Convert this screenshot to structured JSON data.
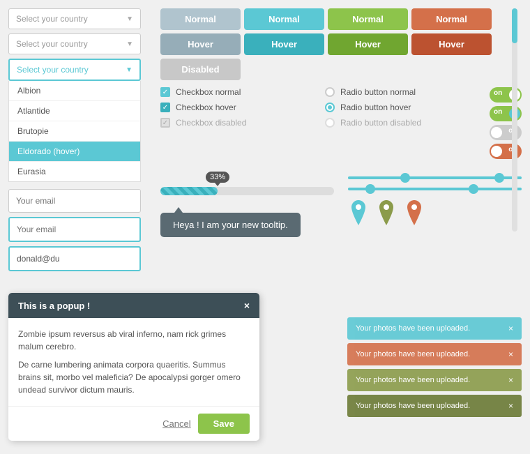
{
  "dropdowns": {
    "normal1": {
      "placeholder": "Select your country",
      "arrow": "▼"
    },
    "normal2": {
      "placeholder": "Select your country",
      "arrow": "▼"
    },
    "active": {
      "placeholder": "Select your country",
      "arrow": "▼"
    },
    "items": [
      "Albion",
      "Atlantide",
      "Brutopie",
      "Eldorado (hover)",
      "Eurasia"
    ]
  },
  "inputs": {
    "placeholder1": "Your email",
    "placeholder2": "Your email",
    "value3": "donald@du"
  },
  "buttons": {
    "row1": [
      "Normal",
      "Normal",
      "Normal",
      "Normal"
    ],
    "row2": [
      "Hover",
      "Hover",
      "Hover",
      "Hover"
    ],
    "row3": [
      "Disabled"
    ]
  },
  "checkboxes": {
    "normal": "Checkbox normal",
    "hover": "Checkbox hover",
    "disabled": "Checkbox disabled"
  },
  "radios": {
    "normal": "Radio button normal",
    "hover": "Radio button hover",
    "disabled": "Radio button disabled"
  },
  "toggles": {
    "on1": "on",
    "on2": "on",
    "off1": "off",
    "off2": "off"
  },
  "slider": {
    "percent": "33%"
  },
  "tooltip": {
    "text": "Heya ! I am your new tooltip."
  },
  "popup": {
    "title": "This is a popup !",
    "close": "×",
    "body1": "Zombie ipsum reversus ab viral inferno, nam rick grimes malum cerebro.",
    "body2": "De carne lumbering animata corpora quaeritis. Summus brains sit, morbo vel maleficia? De apocalypsi gorger omero undead survivor dictum mauris.",
    "cancel": "Cancel",
    "save": "Save"
  },
  "notifications": {
    "text": "Your photos have been uploaded.",
    "close": "×"
  }
}
